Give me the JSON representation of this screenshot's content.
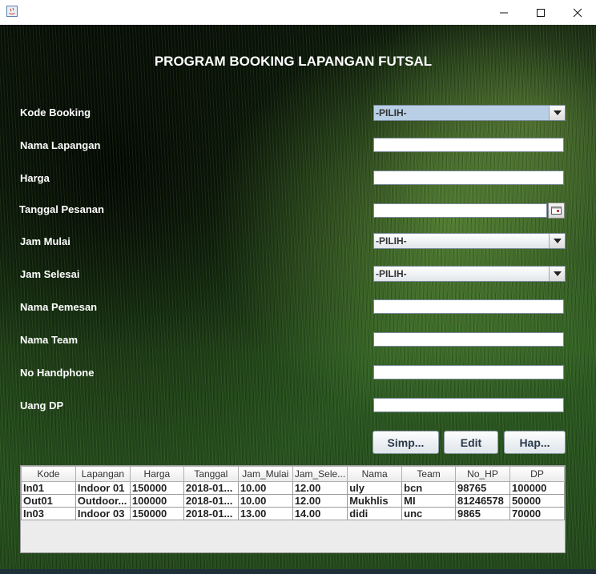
{
  "window": {
    "controls": {
      "minimize": "—",
      "maximize": "☐",
      "close": "✕"
    }
  },
  "heading": "PROGRAM BOOKING LAPANGAN FUTSAL",
  "form": {
    "kode_booking": {
      "label": "Kode Booking",
      "value": "-PILIH-"
    },
    "nama_lapangan": {
      "label": "Nama Lapangan",
      "value": ""
    },
    "harga": {
      "label": "Harga",
      "value": ""
    },
    "tanggal_pesanan": {
      "label": "Tanggal Pesanan",
      "value": ""
    },
    "jam_mulai": {
      "label": "Jam Mulai",
      "value": "-PILIH-"
    },
    "jam_selesai": {
      "label": "Jam Selesai",
      "value": "-PILIH-"
    },
    "nama_pemesan": {
      "label": "Nama Pemesan",
      "value": ""
    },
    "nama_team": {
      "label": "Nama Team",
      "value": ""
    },
    "no_handphone": {
      "label": "No Handphone",
      "value": ""
    },
    "uang_dp": {
      "label": "Uang DP",
      "value": ""
    }
  },
  "buttons": {
    "simpan": "Simp...",
    "edit": "Edit",
    "hapus": "Hap..."
  },
  "table": {
    "columns": [
      "Kode",
      "Lapangan",
      "Harga",
      "Tanggal",
      "Jam_Mulai",
      "Jam_Sele...",
      "Nama",
      "Team",
      "No_HP",
      "DP"
    ],
    "rows": [
      [
        "In01",
        "Indoor 01",
        "150000",
        "2018-01...",
        "10.00",
        "12.00",
        "uly",
        "bcn",
        "98765",
        "100000"
      ],
      [
        "Out01",
        "Outdoor...",
        "100000",
        "2018-01...",
        "10.00",
        "12.00",
        "Mukhlis",
        "MI",
        "81246578",
        "50000"
      ],
      [
        "In03",
        "Indoor 03",
        "150000",
        "2018-01...",
        "13.00",
        "14.00",
        "didi",
        "unc",
        "9865",
        "70000"
      ]
    ]
  },
  "colors": {
    "label_text": "#ffffff",
    "combo_selected": "#b8cfe5"
  },
  "icons": {
    "app": "java-app-icon",
    "date_picker": "calendar-icon",
    "dropdown": "chevron-down-icon"
  }
}
